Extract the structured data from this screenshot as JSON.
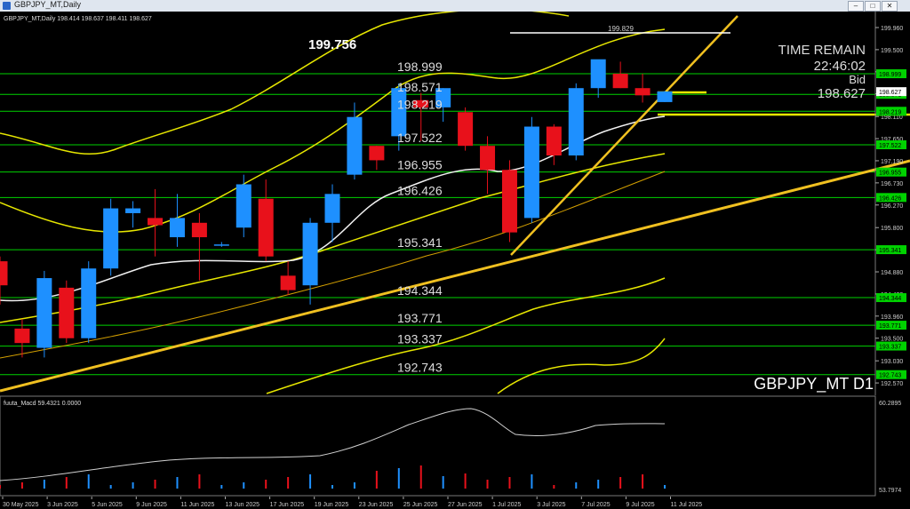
{
  "window": {
    "title": "GBPJPY_MT,Daily",
    "buttons": [
      "–",
      "□",
      "✕"
    ]
  },
  "header": {
    "ohlc": "GBPJPY_MT,Daily  198.414 198.637 198.411 198.627"
  },
  "overlay": {
    "big_price": "199.756",
    "high_marker": "199.829",
    "time_remain_label": "TIME REMAIN",
    "time_remain": "22:46:02",
    "bid_label": "Bid",
    "bid": "198.627",
    "watermark": "GBPJPY_MT D1"
  },
  "level_labels": [
    "198.999",
    "198.571",
    "198.219",
    "197.522",
    "196.955",
    "196.426",
    "195.341",
    "194.344",
    "193.771",
    "193.337",
    "192.743"
  ],
  "macd": {
    "label": "fuuta_Macd 59.4321  0.0000",
    "top": "60.2895",
    "bottom": "53.7974"
  },
  "colors": {
    "up": "#1e90ff",
    "down": "#e8111b",
    "level_line": "#00d200",
    "channel": "#e6e600",
    "trend": "#f0c020",
    "grid_label_bg": "#00d200"
  },
  "chart_data": {
    "type": "candlestick",
    "symbol": "GBPJPY_MT",
    "timeframe": "D1",
    "ylim": [
      192.35,
      200.2
    ],
    "price_ticks": [
      "199.960",
      "199.500",
      "199.040",
      "198.580",
      "198.110",
      "197.650",
      "197.190",
      "196.730",
      "196.270",
      "195.800",
      "195.340",
      "194.880",
      "194.420",
      "193.960",
      "193.500",
      "193.030",
      "192.570"
    ],
    "level_lines": [
      198.999,
      198.571,
      198.219,
      197.522,
      196.955,
      196.426,
      195.341,
      194.344,
      193.771,
      193.337,
      192.743
    ],
    "date_labels": [
      "30 May 2025",
      "3 Jun 2025",
      "5 Jun 2025",
      "9 Jun 2025",
      "11 Jun 2025",
      "13 Jun 2025",
      "17 Jun 2025",
      "19 Jun 2025",
      "23 Jun 2025",
      "25 Jun 2025",
      "27 Jun 2025",
      "1 Jul 2025",
      "3 Jul 2025",
      "7 Jul 2025",
      "9 Jul 2025",
      "11 Jul 2025"
    ],
    "candles": [
      {
        "o": 195.1,
        "h": 195.2,
        "l": 194.2,
        "c": 194.6
      },
      {
        "o": 193.7,
        "h": 193.9,
        "l": 193.1,
        "c": 193.4
      },
      {
        "o": 193.3,
        "h": 194.9,
        "l": 193.1,
        "c": 194.75
      },
      {
        "o": 194.55,
        "h": 194.7,
        "l": 193.4,
        "c": 193.5
      },
      {
        "o": 193.5,
        "h": 195.1,
        "l": 193.4,
        "c": 194.95
      },
      {
        "o": 194.95,
        "h": 196.4,
        "l": 194.8,
        "c": 196.2
      },
      {
        "o": 196.1,
        "h": 196.35,
        "l": 195.8,
        "c": 196.2
      },
      {
        "o": 196.0,
        "h": 196.6,
        "l": 195.2,
        "c": 195.85
      },
      {
        "o": 195.6,
        "h": 196.5,
        "l": 195.4,
        "c": 196.0
      },
      {
        "o": 195.9,
        "h": 196.1,
        "l": 194.7,
        "c": 195.6
      },
      {
        "o": 195.45,
        "h": 195.5,
        "l": 195.4,
        "c": 195.45
      },
      {
        "o": 195.8,
        "h": 196.9,
        "l": 195.6,
        "c": 196.7
      },
      {
        "o": 196.4,
        "h": 196.8,
        "l": 195.1,
        "c": 195.2
      },
      {
        "o": 194.8,
        "h": 195.1,
        "l": 194.4,
        "c": 194.5
      },
      {
        "o": 194.6,
        "h": 196.0,
        "l": 194.2,
        "c": 195.9
      },
      {
        "o": 195.9,
        "h": 196.7,
        "l": 195.5,
        "c": 196.5
      },
      {
        "o": 196.9,
        "h": 198.4,
        "l": 196.8,
        "c": 198.1
      },
      {
        "o": 197.5,
        "h": 197.5,
        "l": 197.0,
        "c": 197.2
      },
      {
        "o": 197.7,
        "h": 198.8,
        "l": 197.4,
        "c": 198.7
      },
      {
        "o": 198.45,
        "h": 198.6,
        "l": 197.6,
        "c": 198.3
      },
      {
        "o": 198.3,
        "h": 198.7,
        "l": 198.0,
        "c": 198.7
      },
      {
        "o": 198.2,
        "h": 198.3,
        "l": 197.4,
        "c": 197.5
      },
      {
        "o": 197.5,
        "h": 197.7,
        "l": 196.5,
        "c": 197.0
      },
      {
        "o": 197.0,
        "h": 197.2,
        "l": 195.5,
        "c": 195.7
      },
      {
        "o": 196.0,
        "h": 198.1,
        "l": 195.9,
        "c": 197.9
      },
      {
        "o": 197.9,
        "h": 197.95,
        "l": 197.1,
        "c": 197.3
      },
      {
        "o": 197.3,
        "h": 198.8,
        "l": 197.2,
        "c": 198.7
      },
      {
        "o": 198.7,
        "h": 199.2,
        "l": 198.5,
        "c": 199.3
      },
      {
        "o": 199.0,
        "h": 199.25,
        "l": 198.7,
        "c": 198.7
      },
      {
        "o": 198.7,
        "h": 199.0,
        "l": 198.4,
        "c": 198.55
      },
      {
        "o": 198.41,
        "h": 198.64,
        "l": 198.41,
        "c": 198.63
      }
    ]
  }
}
